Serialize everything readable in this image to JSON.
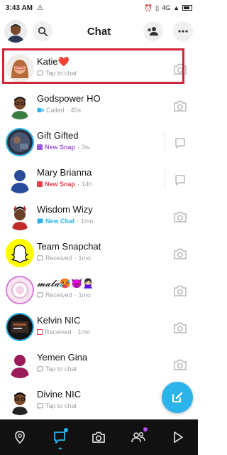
{
  "status_bar": {
    "time": "3:43",
    "meridiem": "AM",
    "network": "4G"
  },
  "header": {
    "title": "Chat"
  },
  "chats": [
    {
      "name": "Katie",
      "emoji": "❤️",
      "status": "",
      "detail": "Tap to chat",
      "time": "",
      "status_color": "#9aa0a6",
      "action": "camera-icon"
    },
    {
      "name": "Godspower HO",
      "emoji": "",
      "status": "",
      "detail": "Called",
      "time": "45s",
      "status_color": "#2bb4ec",
      "action": "camera-icon"
    },
    {
      "name": "Gift Gifted",
      "emoji": "",
      "status": "New Snap",
      "detail": "",
      "time": "3w",
      "status_color": "#9b59d6",
      "action": "reply-icon"
    },
    {
      "name": "Mary Brianna",
      "emoji": "",
      "status": "New Snap",
      "detail": "",
      "time": "14h",
      "status_color": "#e9404f",
      "action": "reply-icon"
    },
    {
      "name": "Wisdom Wizy",
      "emoji": "",
      "status": "New Chat",
      "detail": "",
      "time": "1mo",
      "status_color": "#2bb4ec",
      "action": "camera-icon"
    },
    {
      "name": "Team Snapchat",
      "emoji": "",
      "status": "",
      "detail": "Received",
      "time": "1mo",
      "status_color": "#9aa0a6",
      "action": "camera-icon"
    },
    {
      "name": "𝓶𝓪𝓵𝓪",
      "emoji": "🥵😈🙅🏻‍♀️",
      "status": "",
      "detail": "Received",
      "time": "1mo",
      "status_color": "#9aa0a6",
      "action": "camera-icon"
    },
    {
      "name": "Kelvin NIC",
      "emoji": "",
      "status": "",
      "detail": "Received",
      "time": "1mo",
      "status_color": "#e9404f",
      "action": "camera-icon"
    },
    {
      "name": "Yemen Gina",
      "emoji": "",
      "status": "",
      "detail": "Tap to chat",
      "time": "",
      "status_color": "#9aa0a6",
      "action": "camera-icon"
    },
    {
      "name": "Divine NIC",
      "emoji": "",
      "status": "",
      "detail": "Tap to chat",
      "time": "",
      "status_color": "#9aa0a6",
      "action": "camera-icon"
    }
  ],
  "colors": {
    "accent_blue": "#2bb4ec",
    "highlight_red": "#d0243a",
    "nav_bg": "#111111"
  },
  "bottom_nav": [
    "map-icon",
    "chat-icon",
    "camera-icon",
    "friends-icon",
    "play-icon"
  ]
}
